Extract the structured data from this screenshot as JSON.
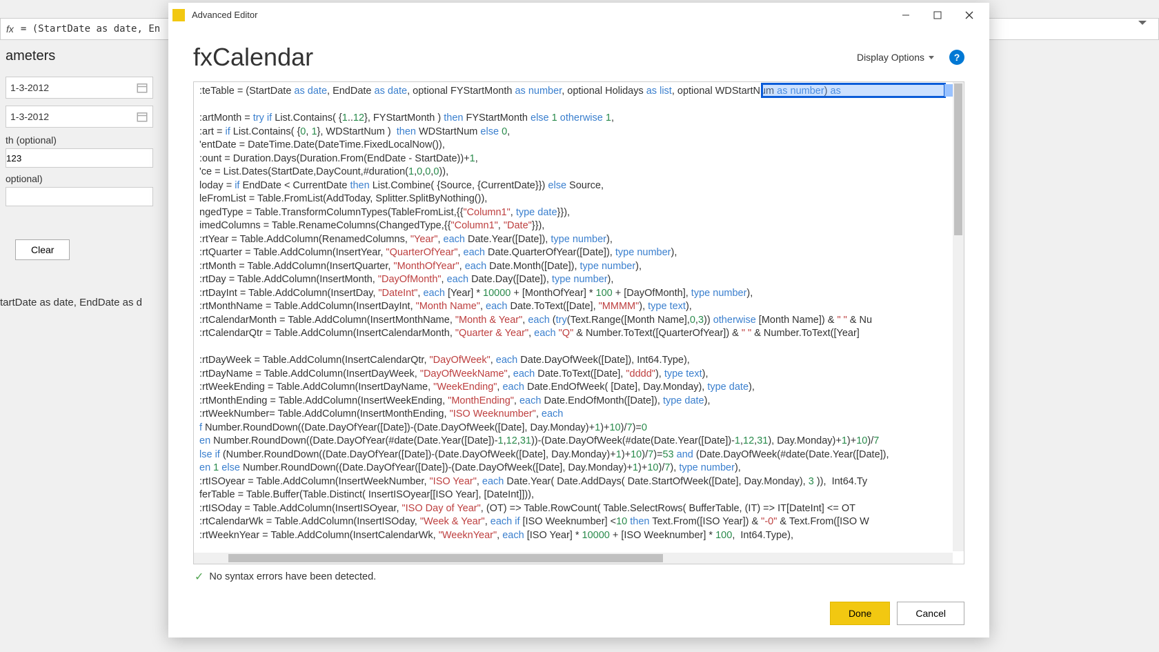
{
  "background": {
    "fx": "fx",
    "formula": "= (StartDate as date, En",
    "panel_title": "ameters",
    "date1": "1-3-2012",
    "date2": "1-3-2012",
    "label1": "th (optional)",
    "field1": "123",
    "label2": "optional)",
    "clear": "Clear",
    "signature": "tartDate as date, EndDate as d"
  },
  "modal": {
    "app_title": "Advanced Editor",
    "query_name": "fxCalendar",
    "display_options": "Display Options",
    "status": "No syntax errors have been detected.",
    "done": "Done",
    "cancel": "Cancel"
  },
  "code_lines": [
    {
      "t": ":teTable = (StartDate ",
      "r": [
        {
          "c": "kw",
          "t": "as"
        },
        {
          "t": " "
        },
        {
          "c": "ty",
          "t": "date"
        },
        {
          "t": ", EndDate "
        },
        {
          "c": "kw",
          "t": "as"
        },
        {
          "t": " "
        },
        {
          "c": "ty",
          "t": "date"
        },
        {
          "t": ", optional FYStartMonth "
        },
        {
          "c": "kw",
          "t": "as"
        },
        {
          "t": " "
        },
        {
          "c": "ty",
          "t": "number"
        },
        {
          "t": ", optional Holidays "
        },
        {
          "c": "kw",
          "t": "as"
        },
        {
          "t": " "
        },
        {
          "c": "ty",
          "t": "list"
        },
        {
          "t": ", optional WDStartNum "
        },
        {
          "c": "kw",
          "t": "as"
        },
        {
          "t": " "
        },
        {
          "c": "ty",
          "t": "number"
        },
        {
          "t": ") "
        },
        {
          "c": "kw",
          "t": "as"
        }
      ]
    },
    {
      "t": ""
    },
    {
      "t": ":artMonth = ",
      "r": [
        {
          "c": "kw",
          "t": "try if"
        },
        {
          "t": " List.Contains( {"
        },
        {
          "c": "num",
          "t": "1"
        },
        {
          "t": ".."
        },
        {
          "c": "num",
          "t": "12"
        },
        {
          "t": "}, FYStartMonth ) "
        },
        {
          "c": "kw",
          "t": "then"
        },
        {
          "t": " FYStartMonth "
        },
        {
          "c": "kw",
          "t": "else"
        },
        {
          "t": " "
        },
        {
          "c": "num",
          "t": "1"
        },
        {
          "t": " "
        },
        {
          "c": "kw",
          "t": "otherwise"
        },
        {
          "t": " "
        },
        {
          "c": "num",
          "t": "1"
        },
        {
          "t": ","
        }
      ]
    },
    {
      "t": ":art = ",
      "r": [
        {
          "c": "kw",
          "t": "if"
        },
        {
          "t": " List.Contains( {"
        },
        {
          "c": "num",
          "t": "0"
        },
        {
          "t": ", "
        },
        {
          "c": "num",
          "t": "1"
        },
        {
          "t": "}, WDStartNum )  "
        },
        {
          "c": "kw",
          "t": "then"
        },
        {
          "t": " WDStartNum "
        },
        {
          "c": "kw",
          "t": "else"
        },
        {
          "t": " "
        },
        {
          "c": "num",
          "t": "0"
        },
        {
          "t": ","
        }
      ]
    },
    {
      "t": "'entDate = DateTime.Date(DateTime.FixedLocalNow()),"
    },
    {
      "t": ":ount = Duration.Days(Duration.From(EndDate - StartDate))+",
      "r": [
        {
          "c": "num",
          "t": "1"
        },
        {
          "t": ","
        }
      ]
    },
    {
      "t": "'ce = List.Dates(StartDate,DayCount,#duration(",
      "r": [
        {
          "c": "num",
          "t": "1"
        },
        {
          "t": ","
        },
        {
          "c": "num",
          "t": "0"
        },
        {
          "t": ","
        },
        {
          "c": "num",
          "t": "0"
        },
        {
          "t": ","
        },
        {
          "c": "num",
          "t": "0"
        },
        {
          "t": ")),"
        }
      ]
    },
    {
      "t": "loday = ",
      "r": [
        {
          "c": "kw",
          "t": "if"
        },
        {
          "t": " EndDate < CurrentDate "
        },
        {
          "c": "kw",
          "t": "then"
        },
        {
          "t": " List.Combine( {Source, {CurrentDate}}) "
        },
        {
          "c": "kw",
          "t": "else"
        },
        {
          "t": " Source,"
        }
      ]
    },
    {
      "t": "leFromList = Table.FromList(AddToday, Splitter.SplitByNothing()),"
    },
    {
      "t": "ngedType = Table.TransformColumnTypes(TableFromList,{{",
      "r": [
        {
          "c": "str",
          "t": "\"Column1\""
        },
        {
          "t": ", "
        },
        {
          "c": "kw",
          "t": "type"
        },
        {
          "t": " "
        },
        {
          "c": "ty",
          "t": "date"
        },
        {
          "t": "}}),"
        }
      ]
    },
    {
      "t": "imedColumns = Table.RenameColumns(ChangedType,{{",
      "r": [
        {
          "c": "str",
          "t": "\"Column1\""
        },
        {
          "t": ", "
        },
        {
          "c": "str",
          "t": "\"Date\""
        },
        {
          "t": "}}),"
        }
      ]
    },
    {
      "t": ":rtYear = Table.AddColumn(RenamedColumns, ",
      "r": [
        {
          "c": "str",
          "t": "\"Year\""
        },
        {
          "t": ", "
        },
        {
          "c": "kw",
          "t": "each"
        },
        {
          "t": " Date.Year([Date]), "
        },
        {
          "c": "kw",
          "t": "type"
        },
        {
          "t": " "
        },
        {
          "c": "ty",
          "t": "number"
        },
        {
          "t": "),"
        }
      ]
    },
    {
      "t": ":rtQuarter = Table.AddColumn(InsertYear, ",
      "r": [
        {
          "c": "str",
          "t": "\"QuarterOfYear\""
        },
        {
          "t": ", "
        },
        {
          "c": "kw",
          "t": "each"
        },
        {
          "t": " Date.QuarterOfYear([Date]), "
        },
        {
          "c": "kw",
          "t": "type"
        },
        {
          "t": " "
        },
        {
          "c": "ty",
          "t": "number"
        },
        {
          "t": "),"
        }
      ]
    },
    {
      "t": ":rtMonth = Table.AddColumn(InsertQuarter, ",
      "r": [
        {
          "c": "str",
          "t": "\"MonthOfYear\""
        },
        {
          "t": ", "
        },
        {
          "c": "kw",
          "t": "each"
        },
        {
          "t": " Date.Month([Date]), "
        },
        {
          "c": "kw",
          "t": "type"
        },
        {
          "t": " "
        },
        {
          "c": "ty",
          "t": "number"
        },
        {
          "t": "),"
        }
      ]
    },
    {
      "t": ":rtDay = Table.AddColumn(InsertMonth, ",
      "r": [
        {
          "c": "str",
          "t": "\"DayOfMonth\""
        },
        {
          "t": ", "
        },
        {
          "c": "kw",
          "t": "each"
        },
        {
          "t": " Date.Day([Date]), "
        },
        {
          "c": "kw",
          "t": "type"
        },
        {
          "t": " "
        },
        {
          "c": "ty",
          "t": "number"
        },
        {
          "t": "),"
        }
      ]
    },
    {
      "t": ":rtDayInt = Table.AddColumn(InsertDay, ",
      "r": [
        {
          "c": "str",
          "t": "\"DateInt\""
        },
        {
          "t": ", "
        },
        {
          "c": "kw",
          "t": "each"
        },
        {
          "t": " [Year] * "
        },
        {
          "c": "num",
          "t": "10000"
        },
        {
          "t": " + [MonthOfYear] * "
        },
        {
          "c": "num",
          "t": "100"
        },
        {
          "t": " + [DayOfMonth], "
        },
        {
          "c": "kw",
          "t": "type"
        },
        {
          "t": " "
        },
        {
          "c": "ty",
          "t": "number"
        },
        {
          "t": "),"
        }
      ]
    },
    {
      "t": ":rtMonthName = Table.AddColumn(InsertDayInt, ",
      "r": [
        {
          "c": "str",
          "t": "\"Month Name\""
        },
        {
          "t": ", "
        },
        {
          "c": "kw",
          "t": "each"
        },
        {
          "t": " Date.ToText([Date], "
        },
        {
          "c": "str",
          "t": "\"MMMM\""
        },
        {
          "t": "), "
        },
        {
          "c": "kw",
          "t": "type"
        },
        {
          "t": " "
        },
        {
          "c": "ty",
          "t": "text"
        },
        {
          "t": "),"
        }
      ]
    },
    {
      "t": ":rtCalendarMonth = Table.AddColumn(InsertMonthName, ",
      "r": [
        {
          "c": "str",
          "t": "\"Month & Year\""
        },
        {
          "t": ", "
        },
        {
          "c": "kw",
          "t": "each"
        },
        {
          "t": " ("
        },
        {
          "c": "kw",
          "t": "try"
        },
        {
          "t": "(Text.Range([Month Name],"
        },
        {
          "c": "num",
          "t": "0"
        },
        {
          "t": ","
        },
        {
          "c": "num",
          "t": "3"
        },
        {
          "t": ")) "
        },
        {
          "c": "kw",
          "t": "otherwise"
        },
        {
          "t": " [Month Name]) & "
        },
        {
          "c": "str",
          "t": "\" \""
        },
        {
          "t": " & Nu"
        }
      ]
    },
    {
      "t": ":rtCalendarQtr = Table.AddColumn(InsertCalendarMonth, ",
      "r": [
        {
          "c": "str",
          "t": "\"Quarter & Year\""
        },
        {
          "t": ", "
        },
        {
          "c": "kw",
          "t": "each"
        },
        {
          "t": " "
        },
        {
          "c": "str",
          "t": "\"Q\""
        },
        {
          "t": " & Number.ToText([QuarterOfYear]) & "
        },
        {
          "c": "str",
          "t": "\" \""
        },
        {
          "t": " & Number.ToText([Year]"
        }
      ]
    },
    {
      "t": ""
    },
    {
      "t": ":rtDayWeek = Table.AddColumn(InsertCalendarQtr, ",
      "r": [
        {
          "c": "str",
          "t": "\"DayOfWeek\""
        },
        {
          "t": ", "
        },
        {
          "c": "kw",
          "t": "each"
        },
        {
          "t": " Date.DayOfWeek([Date]), Int64.Type),"
        }
      ]
    },
    {
      "t": ":rtDayName = Table.AddColumn(InsertDayWeek, ",
      "r": [
        {
          "c": "str",
          "t": "\"DayOfWeekName\""
        },
        {
          "t": ", "
        },
        {
          "c": "kw",
          "t": "each"
        },
        {
          "t": " Date.ToText([Date], "
        },
        {
          "c": "str",
          "t": "\"dddd\""
        },
        {
          "t": "), "
        },
        {
          "c": "kw",
          "t": "type"
        },
        {
          "t": " "
        },
        {
          "c": "ty",
          "t": "text"
        },
        {
          "t": "),"
        }
      ]
    },
    {
      "t": ":rtWeekEnding = Table.AddColumn(InsertDayName, ",
      "r": [
        {
          "c": "str",
          "t": "\"WeekEnding\""
        },
        {
          "t": ", "
        },
        {
          "c": "kw",
          "t": "each"
        },
        {
          "t": " Date.EndOfWeek( [Date], Day.Monday), "
        },
        {
          "c": "kw",
          "t": "type"
        },
        {
          "t": " "
        },
        {
          "c": "ty",
          "t": "date"
        },
        {
          "t": "),"
        }
      ]
    },
    {
      "t": ":rtMonthEnding = Table.AddColumn(InsertWeekEnding, ",
      "r": [
        {
          "c": "str",
          "t": "\"MonthEnding\""
        },
        {
          "t": ", "
        },
        {
          "c": "kw",
          "t": "each"
        },
        {
          "t": " Date.EndOfMonth([Date]), "
        },
        {
          "c": "kw",
          "t": "type"
        },
        {
          "t": " "
        },
        {
          "c": "ty",
          "t": "date"
        },
        {
          "t": "),"
        }
      ]
    },
    {
      "t": ":rtWeekNumber= Table.AddColumn(InsertMonthEnding, ",
      "r": [
        {
          "c": "str",
          "t": "\"ISO Weeknumber\""
        },
        {
          "t": ", "
        },
        {
          "c": "kw",
          "t": "each"
        }
      ]
    },
    {
      "t": "",
      "r": [
        {
          "c": "kw",
          "t": "f"
        },
        {
          "t": " Number.RoundDown((Date.DayOfYear([Date])-(Date.DayOfWeek([Date], Day.Monday)+"
        },
        {
          "c": "num",
          "t": "1"
        },
        {
          "t": ")+"
        },
        {
          "c": "num",
          "t": "10"
        },
        {
          "t": ")/"
        },
        {
          "c": "num",
          "t": "7"
        },
        {
          "t": ")="
        },
        {
          "c": "num",
          "t": "0"
        }
      ]
    },
    {
      "t": "",
      "r": [
        {
          "c": "kw",
          "t": "en"
        },
        {
          "t": " Number.RoundDown((Date.DayOfYear(#date(Date.Year([Date])-"
        },
        {
          "c": "num",
          "t": "1"
        },
        {
          "t": ","
        },
        {
          "c": "num",
          "t": "12"
        },
        {
          "t": ","
        },
        {
          "c": "num",
          "t": "31"
        },
        {
          "t": "))-(Date.DayOfWeek(#date(Date.Year([Date])-"
        },
        {
          "c": "num",
          "t": "1"
        },
        {
          "t": ","
        },
        {
          "c": "num",
          "t": "12"
        },
        {
          "t": ","
        },
        {
          "c": "num",
          "t": "31"
        },
        {
          "t": "), Day.Monday)+"
        },
        {
          "c": "num",
          "t": "1"
        },
        {
          "t": ")+"
        },
        {
          "c": "num",
          "t": "10"
        },
        {
          "t": ")/"
        },
        {
          "c": "num",
          "t": "7"
        }
      ]
    },
    {
      "t": "",
      "r": [
        {
          "c": "kw",
          "t": "lse if"
        },
        {
          "t": " (Number.RoundDown((Date.DayOfYear([Date])-(Date.DayOfWeek([Date], Day.Monday)+"
        },
        {
          "c": "num",
          "t": "1"
        },
        {
          "t": ")+"
        },
        {
          "c": "num",
          "t": "10"
        },
        {
          "t": ")/"
        },
        {
          "c": "num",
          "t": "7"
        },
        {
          "t": ")="
        },
        {
          "c": "num",
          "t": "53"
        },
        {
          "t": " "
        },
        {
          "c": "kw",
          "t": "and"
        },
        {
          "t": " (Date.DayOfWeek(#date(Date.Year([Date]),"
        }
      ]
    },
    {
      "t": "",
      "r": [
        {
          "c": "kw",
          "t": "en"
        },
        {
          "t": " "
        },
        {
          "c": "num",
          "t": "1"
        },
        {
          "t": " "
        },
        {
          "c": "kw",
          "t": "else"
        },
        {
          "t": " Number.RoundDown((Date.DayOfYear([Date])-(Date.DayOfWeek([Date], Day.Monday)+"
        },
        {
          "c": "num",
          "t": "1"
        },
        {
          "t": ")+"
        },
        {
          "c": "num",
          "t": "10"
        },
        {
          "t": ")/"
        },
        {
          "c": "num",
          "t": "7"
        },
        {
          "t": "), "
        },
        {
          "c": "kw",
          "t": "type"
        },
        {
          "t": " "
        },
        {
          "c": "ty",
          "t": "number"
        },
        {
          "t": "),"
        }
      ]
    },
    {
      "t": ":rtISOyear = Table.AddColumn(InsertWeekNumber, ",
      "r": [
        {
          "c": "str",
          "t": "\"ISO Year\""
        },
        {
          "t": ", "
        },
        {
          "c": "kw",
          "t": "each"
        },
        {
          "t": " Date.Year( Date.AddDays( Date.StartOfWeek([Date], Day.Monday), "
        },
        {
          "c": "num",
          "t": "3"
        },
        {
          "t": " )),  Int64.Ty"
        }
      ]
    },
    {
      "t": "ferTable = Table.Buffer(Table.Distinct( InsertISOyear[[ISO Year], [DateInt]])),"
    },
    {
      "t": ":rtISOday = Table.AddColumn(InsertISOyear, ",
      "r": [
        {
          "c": "str",
          "t": "\"ISO Day of Year\""
        },
        {
          "t": ", (OT) => Table.RowCount( Table.SelectRows( BufferTable, (IT) => IT[DateInt] <= OT"
        }
      ]
    },
    {
      "t": ":rtCalendarWk = Table.AddColumn(InsertISOday, ",
      "r": [
        {
          "c": "str",
          "t": "\"Week & Year\""
        },
        {
          "t": ", "
        },
        {
          "c": "kw",
          "t": "each if"
        },
        {
          "t": " [ISO Weeknumber] <"
        },
        {
          "c": "num",
          "t": "10"
        },
        {
          "t": " "
        },
        {
          "c": "kw",
          "t": "then"
        },
        {
          "t": " Text.From([ISO Year]) & "
        },
        {
          "c": "str",
          "t": "\"-0\""
        },
        {
          "t": " & Text.From([ISO W"
        }
      ]
    },
    {
      "t": ":rtWeeknYear = Table.AddColumn(InsertCalendarWk, ",
      "r": [
        {
          "c": "str",
          "t": "\"WeeknYear\""
        },
        {
          "t": ", "
        },
        {
          "c": "kw",
          "t": "each"
        },
        {
          "t": " [ISO Year] * "
        },
        {
          "c": "num",
          "t": "10000"
        },
        {
          "t": " + [ISO Weeknumber] * "
        },
        {
          "c": "num",
          "t": "100"
        },
        {
          "t": ",  Int64.Type),"
        }
      ]
    }
  ]
}
